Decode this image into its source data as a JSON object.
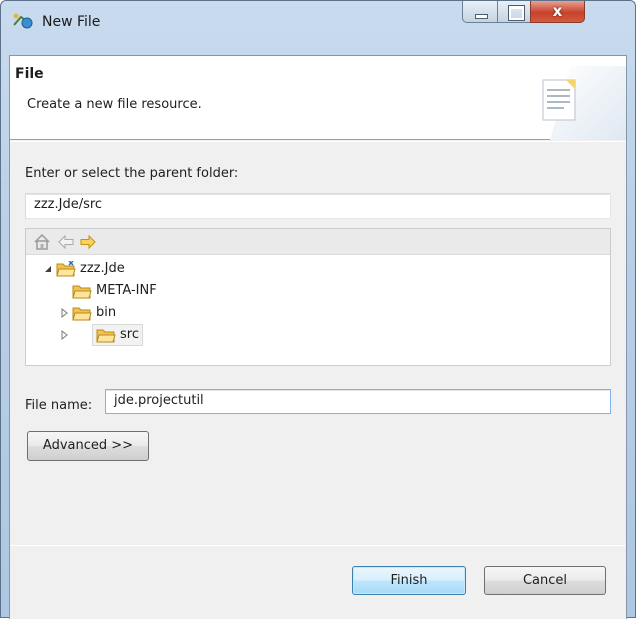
{
  "window": {
    "title": "New File",
    "controls": {
      "minimize_icon": "minimize-icon",
      "maximize_icon": "maximize-icon",
      "close_label": "x"
    }
  },
  "banner": {
    "title": "File",
    "description": "Create a new file resource.",
    "image_icon": "new-file-wizard-icon"
  },
  "parent_folder": {
    "label": "Enter or select the parent folder:",
    "value": "zzz.Jde/src"
  },
  "tree": {
    "toolbar": [
      "home-icon",
      "back-arrow-icon",
      "forward-arrow-icon"
    ],
    "nodes": [
      {
        "label": "zzz.Jde",
        "expanded": true,
        "icon": "project-folder-icon"
      },
      {
        "label": "META-INF",
        "icon": "folder-icon"
      },
      {
        "label": "bin",
        "expanded": false,
        "icon": "folder-icon"
      },
      {
        "label": "src",
        "expanded": false,
        "icon": "folder-icon",
        "selected": true
      }
    ]
  },
  "file_name": {
    "label": "File name:",
    "value": "jde.projectutil"
  },
  "buttons": {
    "advanced": "Advanced >>",
    "finish": "Finish",
    "cancel": "Cancel"
  },
  "colors": {
    "title_bar": "#b9cfe6",
    "close_button": "#c8422b",
    "default_button": "#bee6fd",
    "folder": "#f2c14e"
  }
}
